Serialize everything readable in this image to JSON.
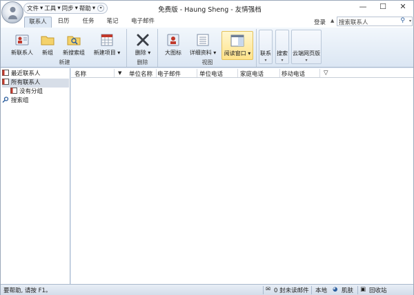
{
  "titlebar": {
    "quick_access": [
      "文件",
      "工具",
      "同步",
      "帮助"
    ],
    "title": "免费版 - Haung Sheng - 友情强档",
    "controls": {
      "minimize": "—",
      "maximize": "☐",
      "close": "✕"
    }
  },
  "tabs": [
    "联系人",
    "日历",
    "任务",
    "笔记",
    "电子邮件"
  ],
  "login_label": "登录",
  "search": {
    "placeholder": "搜索联系人"
  },
  "ribbon": {
    "groups": {
      "new": {
        "label": "新建",
        "buttons": [
          "新联系人",
          "新组",
          "新搜索组",
          "新建项目"
        ]
      },
      "delete": {
        "label": "删除",
        "buttons": [
          "删除"
        ]
      },
      "view": {
        "label": "视图",
        "buttons": [
          "大图标",
          "详细资料",
          "阅读窗口"
        ]
      }
    },
    "small_buttons": [
      "联系",
      "搜索",
      "云端网页版"
    ]
  },
  "nav": {
    "items": [
      "最近联系人",
      "所有联系人",
      "没有分组",
      "搜索组"
    ]
  },
  "list": {
    "columns": [
      "名称",
      "单位名称",
      "电子邮件",
      "单位电话",
      "家庭电话",
      "移动电话"
    ]
  },
  "status": {
    "help": "要帮助, 请按 F1。",
    "unread": "0 封未读邮件",
    "local": "本地",
    "skin": "肌肤",
    "recycle": "回收站"
  }
}
